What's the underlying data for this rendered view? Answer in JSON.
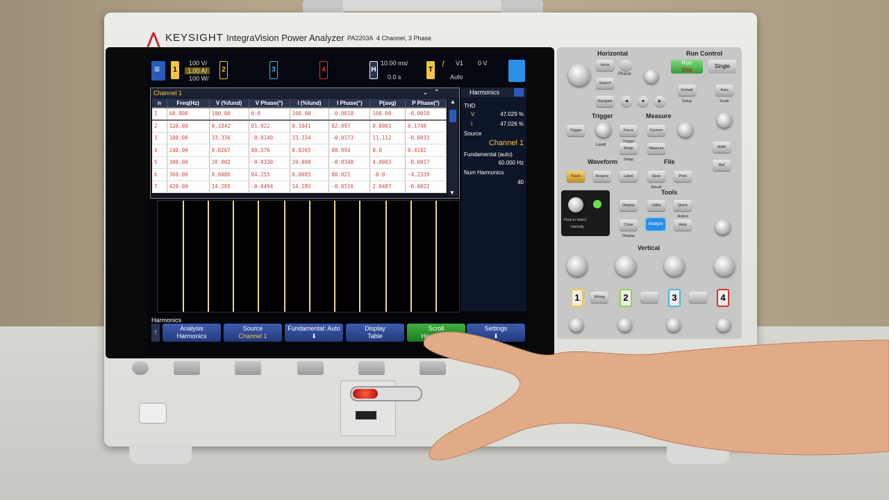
{
  "brand": {
    "logo": "KEYSIGHT",
    "product": "IntegraVision Power Analyzer",
    "model": "PA2203A",
    "spec": "4 Channel, 3 Phase"
  },
  "topbar": {
    "ch1_scale": [
      "100 V/",
      "1.00 A/",
      "100 W/"
    ],
    "ch_labels": [
      "1",
      "2",
      "3",
      "4"
    ],
    "timebase": "10.00 ms/",
    "delay": "0.0 s",
    "trigger_src": "V1",
    "trigger_level": "0 V",
    "trigger_mode": "Auto",
    "h_label": "H",
    "t_label": "T"
  },
  "table": {
    "title": "Channel 1",
    "headers": [
      "n",
      "Freq(Hz)",
      "V (%fund)",
      "V Phase(°)",
      "I (%fund)",
      "I Phase(°)",
      "P(avg)",
      "P Phase(°)"
    ],
    "rows": [
      [
        "1",
        "60.000",
        "100.00",
        "0.0",
        "100.00",
        "-0.0018",
        "100.00",
        "-0.0018"
      ],
      [
        "2",
        "120.00",
        "0.1042",
        "81.922",
        "0.1041",
        "82.097",
        "0.0001",
        "0.1749"
      ],
      [
        "3",
        "180.00",
        "33.336",
        "-0.0140",
        "33.334",
        "-0.0173",
        "11.112",
        "-0.0033"
      ],
      [
        "4",
        "240.00",
        "0.0267",
        "80.576",
        "0.0265",
        "80.994",
        "0.0",
        "0.4182"
      ],
      [
        "5",
        "300.00",
        "20.002",
        "-0.0330",
        "20.000",
        "-0.0348",
        "4.0003",
        "-0.0017"
      ],
      [
        "6",
        "360.00",
        "0.0086",
        "84.255",
        "0.0085",
        "80.021",
        "-0.0",
        "-4.2339"
      ],
      [
        "7",
        "420.00",
        "14.285",
        "-0.0494",
        "14.285",
        "-0.0516",
        "2.0407",
        "-0.0022"
      ]
    ]
  },
  "side": {
    "title": "Harmonics",
    "thd_label": "THD",
    "v_label": "V",
    "v_value": "47.029 %",
    "i_label": "I",
    "i_value": "47.026 %",
    "source_label": "Source",
    "source_value": "Channel 1",
    "fund_label": "Fundamental (auto)",
    "fund_value": "60.000 Hz",
    "num_label": "Num Harmonics",
    "num_value": "40"
  },
  "softkeys": {
    "title": "Harmonics",
    "keys": [
      {
        "label": "Analysis",
        "sub": "Harmonics"
      },
      {
        "label": "Source",
        "sub": "Channel 1"
      },
      {
        "label": "Fundamental: Auto",
        "sub": ""
      },
      {
        "label": "Display",
        "sub": "Table"
      },
      {
        "label": "Scroll",
        "sub": "Harmonics"
      },
      {
        "label": "Settings",
        "sub": ""
      }
    ]
  },
  "panel": {
    "horizontal": "Horizontal",
    "run_control": "Run Control",
    "run": "Run",
    "stop": "Stop",
    "single": "Single",
    "trigger": "Trigger",
    "measure": "Measure",
    "waveform": "Waveform",
    "file": "File",
    "tools": "Tools",
    "vertical": "Vertical",
    "horiz_btn": "Horiz",
    "search_btn": "Search",
    "navigate_btn": "Navigate",
    "phasor": "Phasor",
    "default_setup": "Default Setup",
    "auto_scale": "Auto Scale",
    "trigger_btn": "Trigger",
    "force_trigger": "Force Trigger",
    "level": "Level",
    "mode_setup": "Mode Setup",
    "cursors": "Cursors",
    "measure_btn": "Measure",
    "math": "Math",
    "ref": "Ref",
    "touch": "Touch",
    "acquire": "Acquire",
    "label": "Label",
    "save_recall": "Save Recall",
    "print": "Print",
    "display": "Display",
    "utility": "Utility",
    "quick_action": "Quick Action",
    "clear_display": "Clear Display",
    "analyze": "Analyze",
    "help": "Help",
    "wiring": "Wiring",
    "push_select": "Push to Select",
    "intensity": "Intensity",
    "channels": [
      "1",
      "2",
      "3",
      "4"
    ]
  },
  "colors": {
    "ch1": "#f5c542",
    "ch2": "#8fd14f",
    "ch3": "#40b8e8",
    "ch4": "#e0302a",
    "accent": "#2a5bb8"
  }
}
